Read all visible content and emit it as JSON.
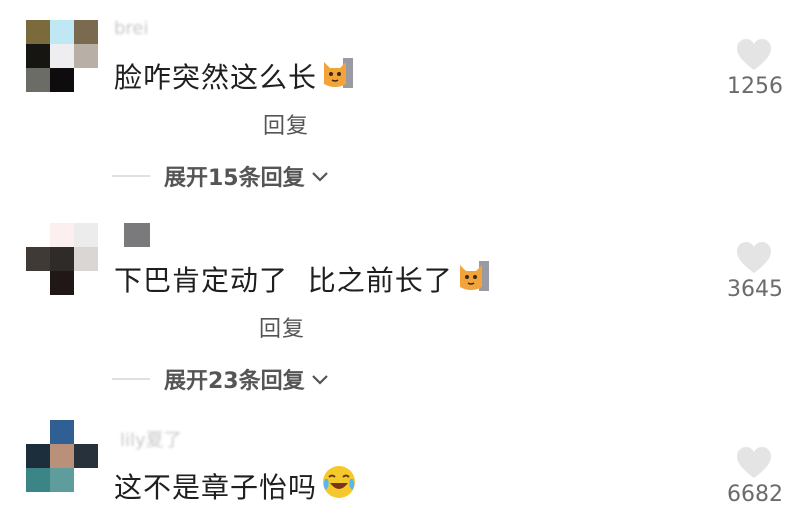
{
  "comments": [
    {
      "username": "brei",
      "text": "脸咋突然这么长",
      "emoji": "cat-emoji",
      "reply_label": "回复",
      "expand_label": "展开15条回复",
      "likes": "1256",
      "avatar_colors": [
        "#7b6a3c",
        "#bfe8f4",
        "#7a6a50",
        "#171512",
        "#eeeef0",
        "#b8b0a6",
        "#6c6c66",
        "#0e0c0c",
        "#ffffff"
      ]
    },
    {
      "username": "",
      "text": "下巴肯定动了  比之前长了",
      "emoji": "cat-emoji",
      "reply_label": "回复",
      "expand_label": "展开23条回复",
      "likes": "3645",
      "avatar_colors": [
        "#ffffff",
        "#fceff0",
        "#ececec",
        "#3f3a36",
        "#2f2b29",
        "#d9d6d4",
        "#ffffff",
        "#1f1817",
        "#ffffff"
      ]
    },
    {
      "username": "lily夏了",
      "text": "这不是章子怡吗",
      "emoji": "crying-laughing-face-emoji",
      "likes": "6682",
      "avatar_colors": [
        "#ffffff",
        "#2f5f93",
        "#ffffff",
        "#1c2e3b",
        "#b9917a",
        "#26313c",
        "#3b8586",
        "#5e9d9c",
        "#ffffff"
      ]
    }
  ],
  "colors": {
    "like_icon": "#e4e4e4",
    "text": "#1f1f1f",
    "secondary_text": "#555555",
    "count": "#6b6b6b"
  }
}
